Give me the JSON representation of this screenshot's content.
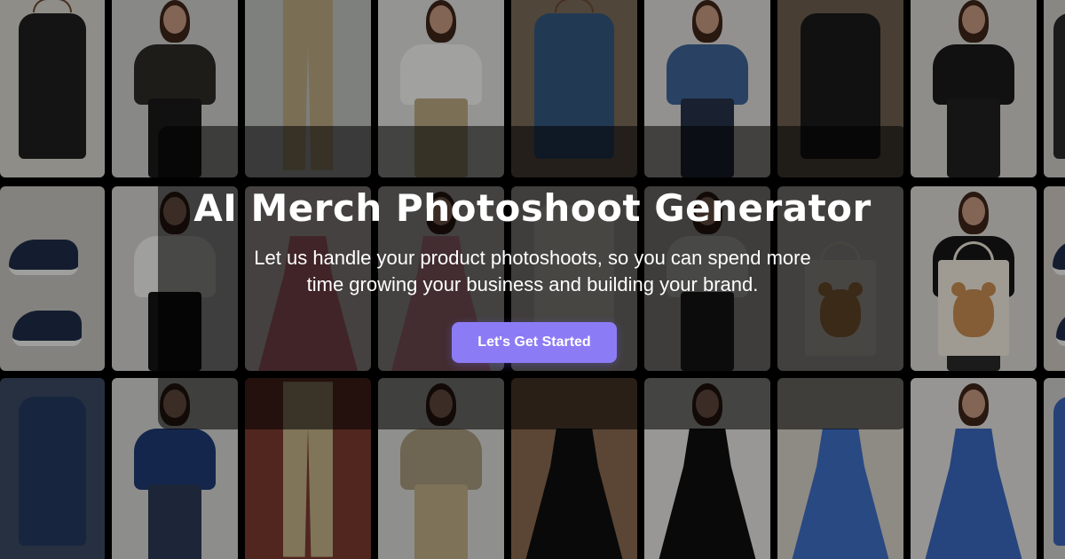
{
  "hero": {
    "title": "AI Merch Photoshoot Generator",
    "subtitle": "Let us handle your product photoshoots, so you can spend more time growing your business and building your brand.",
    "cta_label": "Let's Get Started"
  },
  "colors": {
    "accent": "#8b7cf6",
    "page_background": "#000000",
    "text": "#ffffff"
  },
  "gallery": {
    "rows": [
      [
        {
          "subject": "black hooded jacket on hanger",
          "kind": "hanger",
          "bg": "#d9d6cf",
          "top": "#1e1f1d"
        },
        {
          "subject": "model in black hooded jacket",
          "kind": "model",
          "bg": "#cfcfcb",
          "top": "#2c2b27",
          "bottom": "#1b1b1b"
        },
        {
          "subject": "khaki pants on hanger",
          "kind": "pants",
          "bg": "#bfc2bf",
          "top": "#b9a880"
        },
        {
          "subject": "model in white tee and khaki pants",
          "kind": "model",
          "bg": "#e1e1de",
          "top": "#f4f4f2",
          "bottom": "#bba982"
        },
        {
          "subject": "denim jacket on hanger",
          "kind": "hanger",
          "bg": "#7a6b58",
          "top": "#34577f"
        },
        {
          "subject": "model in denim jacket",
          "kind": "model",
          "bg": "#dedcd9",
          "top": "#3f6496",
          "bottom": "#26324a"
        },
        {
          "subject": "black leather jacket on sofa",
          "kind": "flat",
          "bg": "#6e5e50",
          "top": "#1b1b1b"
        },
        {
          "subject": "model in black leather jacket",
          "kind": "model",
          "bg": "#d8d6d2",
          "top": "#1a1a1a",
          "bottom": "#202020"
        },
        {
          "subject": "dark garment",
          "kind": "flat",
          "bg": "#cfcdc9",
          "top": "#2a2a2a"
        }
      ],
      [
        {
          "subject": "navy sneakers",
          "kind": "shoes",
          "bg": "#c8c5bf"
        },
        {
          "subject": "model in white tee and black pants",
          "kind": "model",
          "bg": "#d6d4d0",
          "top": "#f1f1ef",
          "bottom": "#151515"
        },
        {
          "subject": "floral dress on bed",
          "kind": "dress",
          "bg": "#e9dcd8",
          "top": "#d97a86"
        },
        {
          "subject": "model in floral dress",
          "kind": "dress-model",
          "bg": "#e2dfdc",
          "top": "#e39aa2"
        },
        {
          "subject": "white cap",
          "kind": "flat",
          "bg": "#d9d4cc",
          "top": "#efebe4"
        },
        {
          "subject": "model in white tee",
          "kind": "model",
          "bg": "#d2cfca",
          "top": "#f2f2f0",
          "bottom": "#2a2a2a"
        },
        {
          "subject": "teddy bear tote bag",
          "kind": "bag",
          "bg": "#dcd8d2"
        },
        {
          "subject": "model with teddy bear tote bag",
          "kind": "bag-model",
          "bg": "#dedbd6",
          "top": "#161616",
          "bottom": "#2a2a2a"
        },
        {
          "subject": "white sneakers",
          "kind": "shoes",
          "bg": "#cfcac3"
        }
      ],
      [
        {
          "subject": "navy polo shirt with keys",
          "kind": "flat",
          "bg": "#3a4a63",
          "top": "#243a5e"
        },
        {
          "subject": "model in navy polo shirt",
          "kind": "model",
          "bg": "#d7d6d3",
          "top": "#1f3a74",
          "bottom": "#2d3a55"
        },
        {
          "subject": "khaki pants on rug",
          "kind": "pants",
          "bg": "#7c3b2f",
          "top": "#c2b188"
        },
        {
          "subject": "model in olive tee and khaki pants",
          "kind": "model",
          "bg": "#dadad7",
          "top": "#a8997d",
          "bottom": "#bfae86"
        },
        {
          "subject": "black gown on hanger",
          "kind": "dress",
          "bg": "#8a6a4f",
          "top": "#0e0e0e"
        },
        {
          "subject": "model in black gown",
          "kind": "dress-model",
          "bg": "#e7e6e4",
          "top": "#0f0f0f"
        },
        {
          "subject": "blue sequin dress",
          "kind": "dress",
          "bg": "#d8d2c9",
          "top": "#3f6fc7"
        },
        {
          "subject": "model in blue floral dress",
          "kind": "dress-model",
          "bg": "#e4e3e1",
          "top": "#3a68bf"
        },
        {
          "subject": "blue garment",
          "kind": "flat",
          "bg": "#cfcfcd",
          "top": "#3a63b5"
        }
      ]
    ]
  }
}
